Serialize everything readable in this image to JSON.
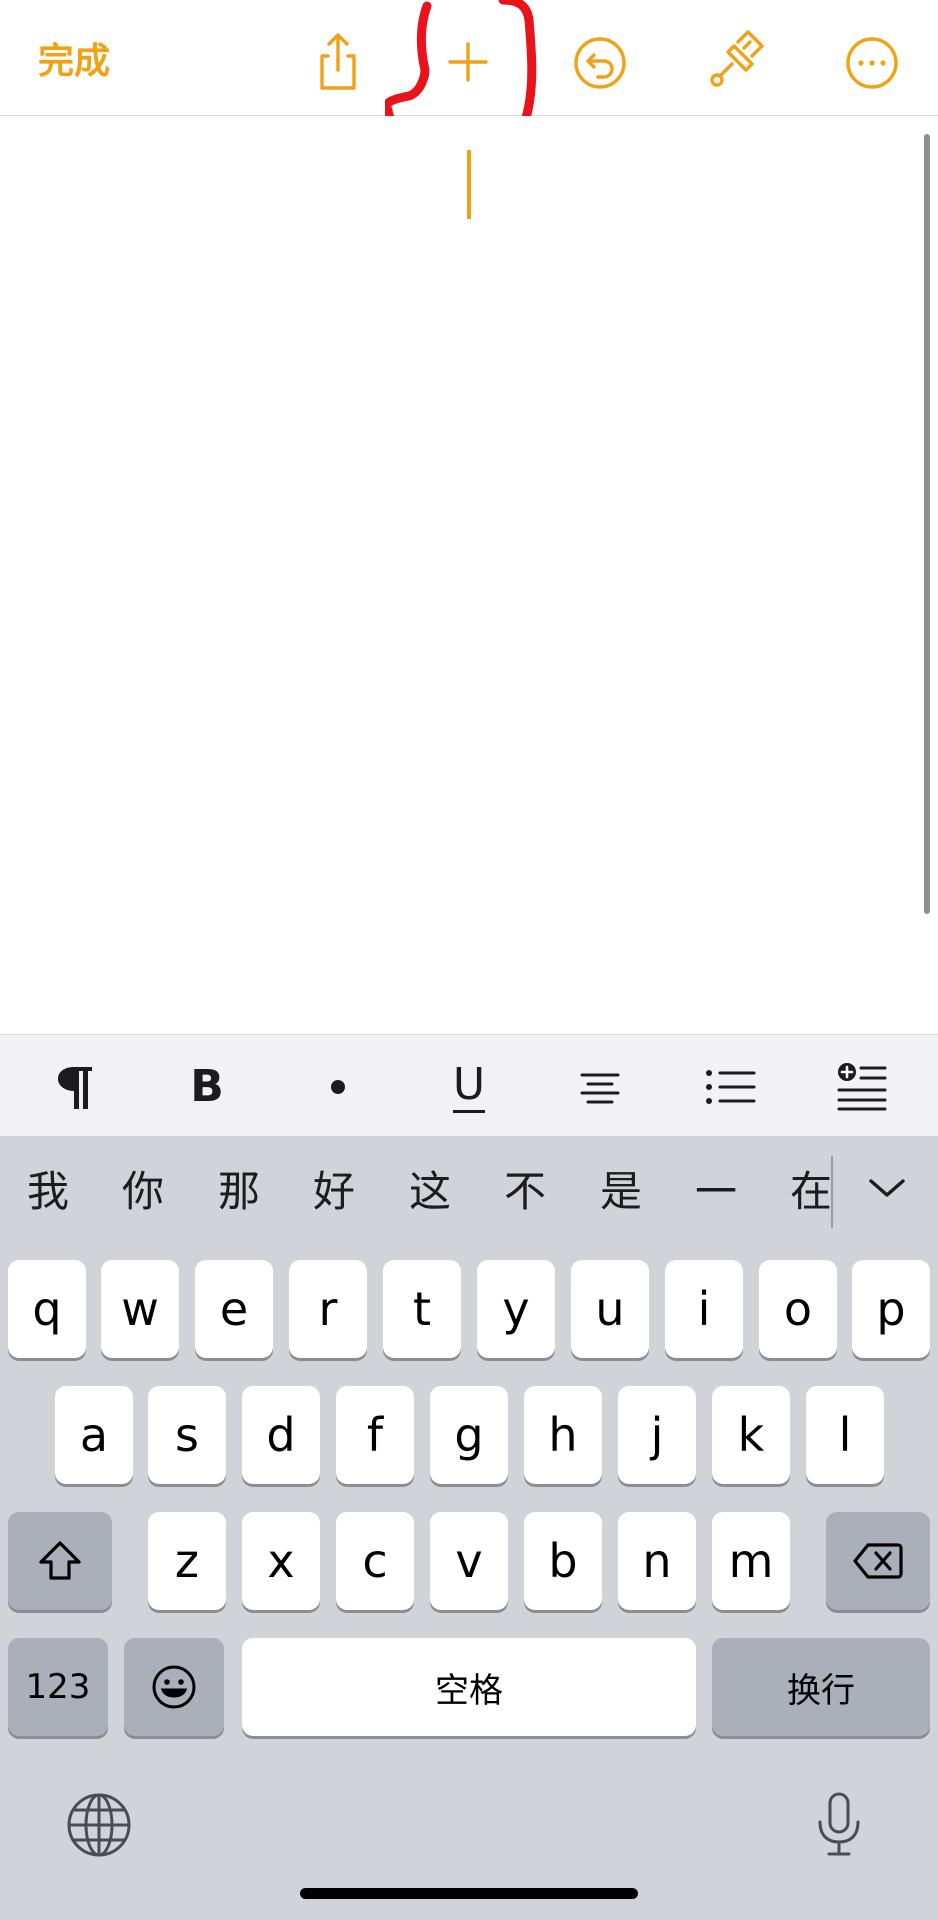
{
  "toolbar": {
    "done_label": "完成",
    "accent_color": "#f1a116",
    "icons": [
      "share-icon",
      "plus-icon",
      "undo-icon",
      "paintbrush-icon",
      "more-icon"
    ]
  },
  "annotation": {
    "color": "#e8131b"
  },
  "format_bar": {
    "bold_label": "B",
    "underline_label": "U",
    "icons": [
      "paragraph-icon",
      "bold-icon",
      "bullet-icon",
      "underline-icon",
      "align-center-icon",
      "list-icon",
      "insert-icon"
    ]
  },
  "candidates": [
    "我",
    "你",
    "那",
    "好",
    "这",
    "不",
    "是",
    "一",
    "在"
  ],
  "keyboard": {
    "row1": [
      "q",
      "w",
      "e",
      "r",
      "t",
      "y",
      "u",
      "i",
      "o",
      "p"
    ],
    "row2": [
      "a",
      "s",
      "d",
      "f",
      "g",
      "h",
      "j",
      "k",
      "l"
    ],
    "row3": [
      "z",
      "x",
      "c",
      "v",
      "b",
      "n",
      "m"
    ],
    "numbers_label": "123",
    "space_label": "空格",
    "return_label": "换行"
  }
}
